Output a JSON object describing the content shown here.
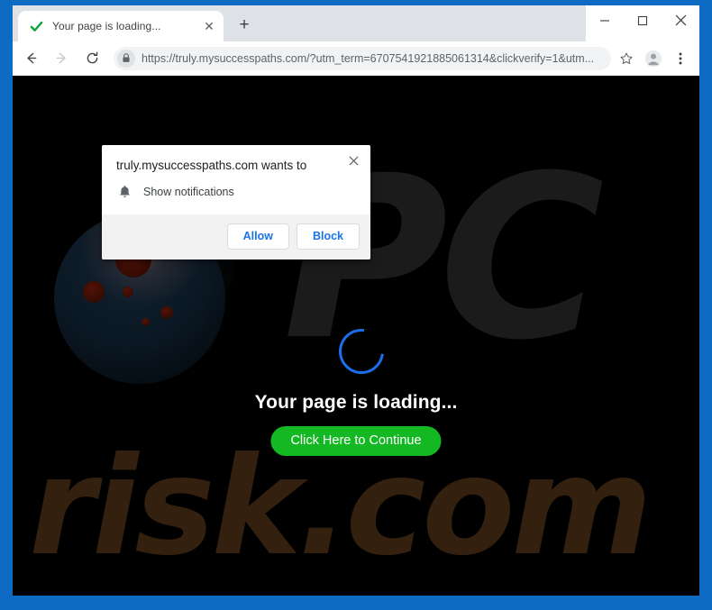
{
  "window": {
    "frame_color": "#0d6bc4",
    "controls": {
      "minimize": "minimize-icon",
      "maximize": "maximize-icon",
      "close": "close-icon"
    }
  },
  "tabstrip": {
    "tabs": [
      {
        "title": "Your page is loading...",
        "favicon": "green-check-icon",
        "close_label": "✕",
        "active": true
      }
    ],
    "new_tab_label": "+"
  },
  "toolbar": {
    "back_icon": "back-arrow-icon",
    "forward_icon": "forward-arrow-icon",
    "reload_icon": "reload-icon",
    "lock_icon": "lock-icon",
    "url_scheme": "https://",
    "url_host": "truly.mysuccesspaths.com",
    "url_path": "/?utm_term=6707541921885061314&clickverify=1&utm...",
    "url_full": "https://truly.mysuccesspaths.com/?utm_term=6707541921885061314&clickverify=1&utm...",
    "star_icon": "bookmark-star-icon",
    "profile_icon": "profile-avatar-icon",
    "menu_icon": "three-dot-menu-icon"
  },
  "dialog": {
    "title": "truly.mysuccesspaths.com wants to",
    "permission_icon": "bell-icon",
    "permission_label": "Show notifications",
    "allow_label": "Allow",
    "block_label": "Block",
    "close_label": "✕",
    "accent_color": "#1a73e8"
  },
  "page": {
    "background_color": "#000000",
    "heading": "Your page is loading...",
    "cta_label": "Click Here to Continue",
    "cta_color": "#13b822",
    "spinner_color": "#1a6ff0",
    "watermark_primary": "PC",
    "watermark_secondary": "risk.com",
    "watermark_primary_color": "#1b1b1b",
    "watermark_secondary_color": "#33200e"
  }
}
